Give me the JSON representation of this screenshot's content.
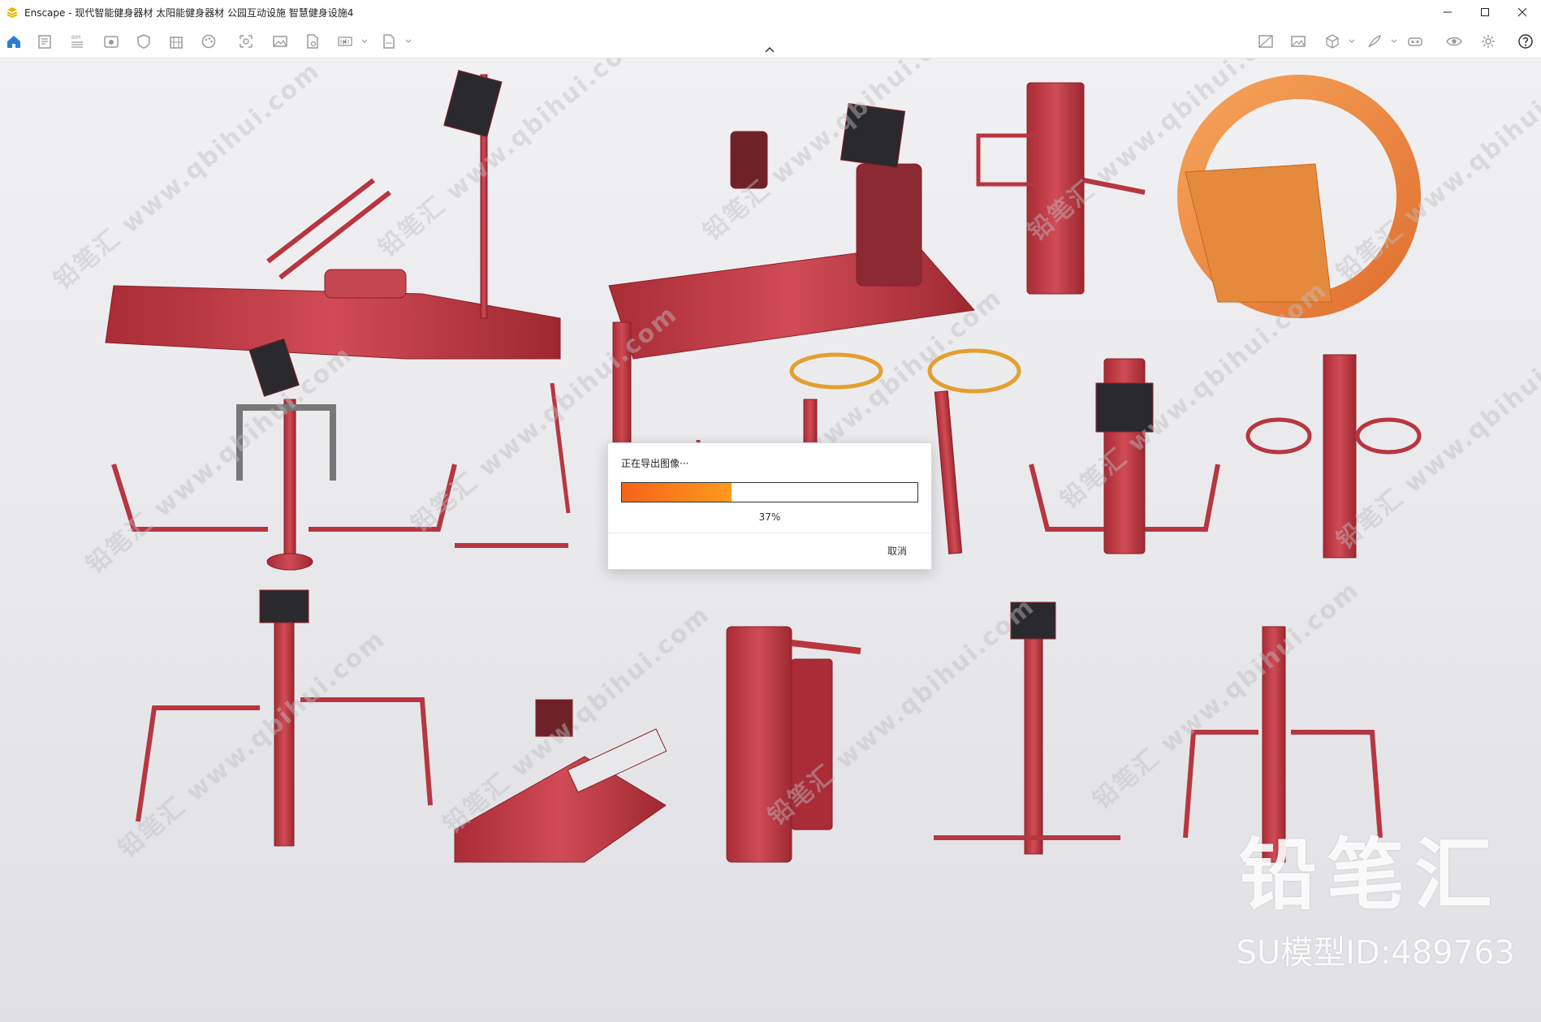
{
  "window": {
    "title": "Enscape - 现代智能健身器材 太阳能健身器材 公园互动设施 智慧健身设施4",
    "controls": {
      "minimize": "minimize-icon",
      "maximize": "maximize-icon",
      "close": "close-icon"
    }
  },
  "toolbar": {
    "left_icons": [
      "home-icon",
      "document-icon",
      "bim-icon",
      "view-icon",
      "shield-icon",
      "building-icon",
      "palette-icon",
      "camera-icon",
      "image-icon",
      "file-icon",
      "png-export-icon",
      "exe-export-icon"
    ],
    "bim_label": "BIM",
    "right_icons": [
      "map-icon",
      "picture-icon",
      "cube-icon",
      "feather-icon",
      "vr-headset-icon",
      "eye-icon",
      "settings-icon",
      "help-icon"
    ],
    "accent_color": "#2a7fd4"
  },
  "viewport": {
    "watermark_text": "铅笔汇 www.qbihui.com",
    "brand_text": "铅笔汇",
    "model_id_text": "SU模型ID:489763",
    "equipment_color": "#c73b45"
  },
  "export_dialog": {
    "title": "正在导出图像···",
    "progress_percent": 37,
    "progress_label": "37%",
    "cancel_label": "取消",
    "progress_colors": [
      "#f4641a",
      "#ff9a1e"
    ]
  }
}
